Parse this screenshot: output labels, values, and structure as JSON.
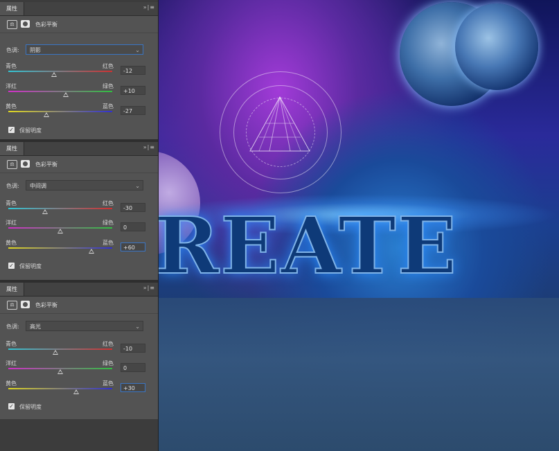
{
  "panels": [
    {
      "tab": "属性",
      "controls": "»|≡",
      "adjustment_title": "色彩平衡",
      "tone_label": "色调:",
      "tone_value": "阴影",
      "sliders": [
        {
          "left": "青色",
          "right": "红色",
          "value": "-12",
          "level": -12
        },
        {
          "left": "洋红",
          "right": "绿色",
          "value": "+10",
          "level": 10
        },
        {
          "left": "黄色",
          "right": "蓝色",
          "value": "-27",
          "level": -27
        }
      ],
      "preserve_label": "保留明度"
    },
    {
      "tab": "属性",
      "controls": "»|≡",
      "adjustment_title": "色彩平衡",
      "tone_label": "色调:",
      "tone_value": "中间调",
      "sliders": [
        {
          "left": "青色",
          "right": "红色",
          "value": "-30",
          "level": -30
        },
        {
          "left": "洋红",
          "right": "绿色",
          "value": "0",
          "level": 0
        },
        {
          "left": "黄色",
          "right": "蓝色",
          "value": "+60",
          "level": 60
        }
      ],
      "preserve_label": "保留明度"
    },
    {
      "tab": "属性",
      "controls": "»|≡",
      "adjustment_title": "色彩平衡",
      "tone_label": "色调:",
      "tone_value": "高光",
      "sliders": [
        {
          "left": "青色",
          "right": "红色",
          "value": "-10",
          "level": -10
        },
        {
          "left": "洋红",
          "right": "绿色",
          "value": "0",
          "level": 0
        },
        {
          "left": "黄色",
          "right": "蓝色",
          "value": "+30",
          "level": 30
        }
      ],
      "preserve_label": "保留明度"
    }
  ],
  "canvas": {
    "text": "REATE"
  },
  "colors": {
    "accent_focus": "#3a75c4",
    "cyan_red": [
      "#31c6d6",
      "#d03030"
    ],
    "magenta_green": [
      "#d030c8",
      "#30c040"
    ],
    "yellow_blue": [
      "#e0d820",
      "#3030d0"
    ]
  }
}
